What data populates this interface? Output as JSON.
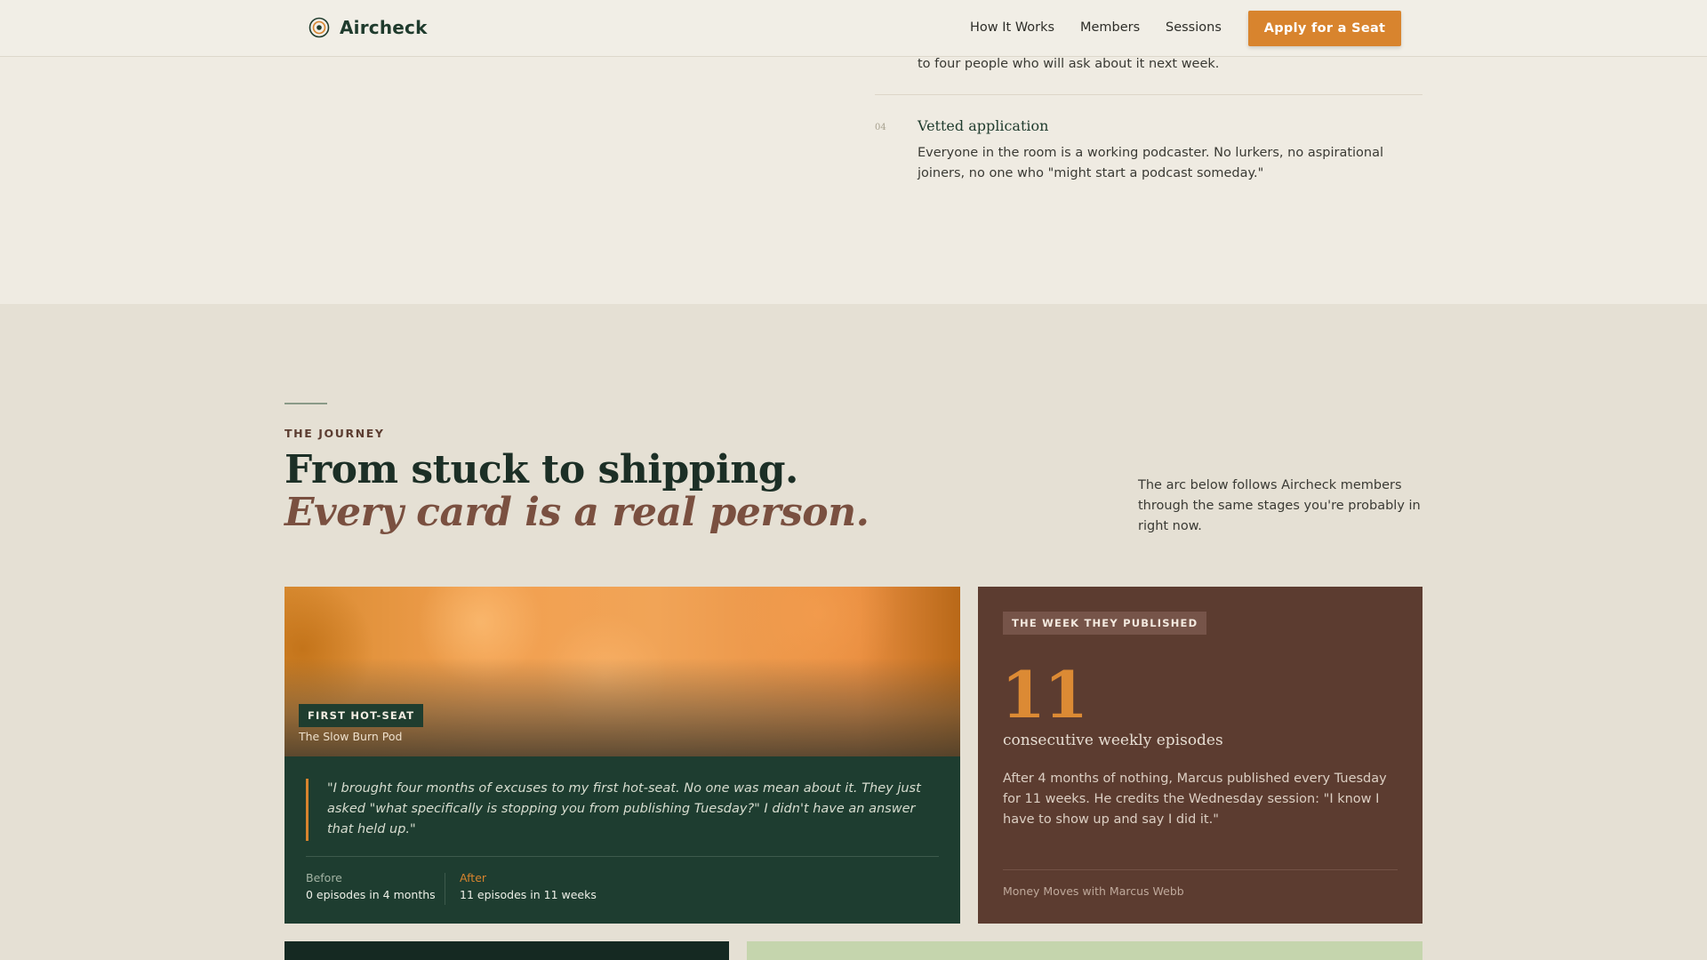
{
  "nav": {
    "brand": "Aircheck",
    "links": [
      "How It Works",
      "Members",
      "Sessions"
    ],
    "cta": "Apply for a Seat"
  },
  "features": {
    "tail_text": "to four people who will ask about it next week.",
    "item4": {
      "number": "04",
      "title": "Vetted application",
      "description": "Everyone in the room is a working podcaster. No lurkers, no aspirational joiners, no one who \"might start a podcast someday.\""
    }
  },
  "journey": {
    "eyebrow": "THE JOURNEY",
    "headline": "From stuck to shipping.",
    "headline_italic": "Every card is a real person.",
    "intro": "The arc below follows Aircheck members through the same stages you're probably in right now."
  },
  "story_card": {
    "badge": "FIRST HOT-SEAT",
    "podcast": "The Slow Burn Pod",
    "quote": "\"I brought four months of excuses to my first hot-seat. No one was mean about it. They just asked \"what specifically is stopping you from publishing Tuesday?\" I didn't have an answer that held up.\"",
    "before_label": "Before",
    "before_value": "0 episodes in 4 months",
    "after_label": "After",
    "after_value": "11 episodes in 11 weeks"
  },
  "stat_card": {
    "badge": "THE WEEK THEY PUBLISHED",
    "number": "11",
    "caption": "consecutive weekly episodes",
    "description": "After 4 months of nothing, Marcus published every Tuesday for 11 weeks. He credits the Wednesday session: \"I know I have to show up and say I did it.\"",
    "podcast": "Money Moves with Marcus Webb"
  },
  "colors": {
    "accent": "#d8842e",
    "forest": "#1e3d30",
    "brown": "#5c3c30",
    "cream": "#efebe2"
  }
}
